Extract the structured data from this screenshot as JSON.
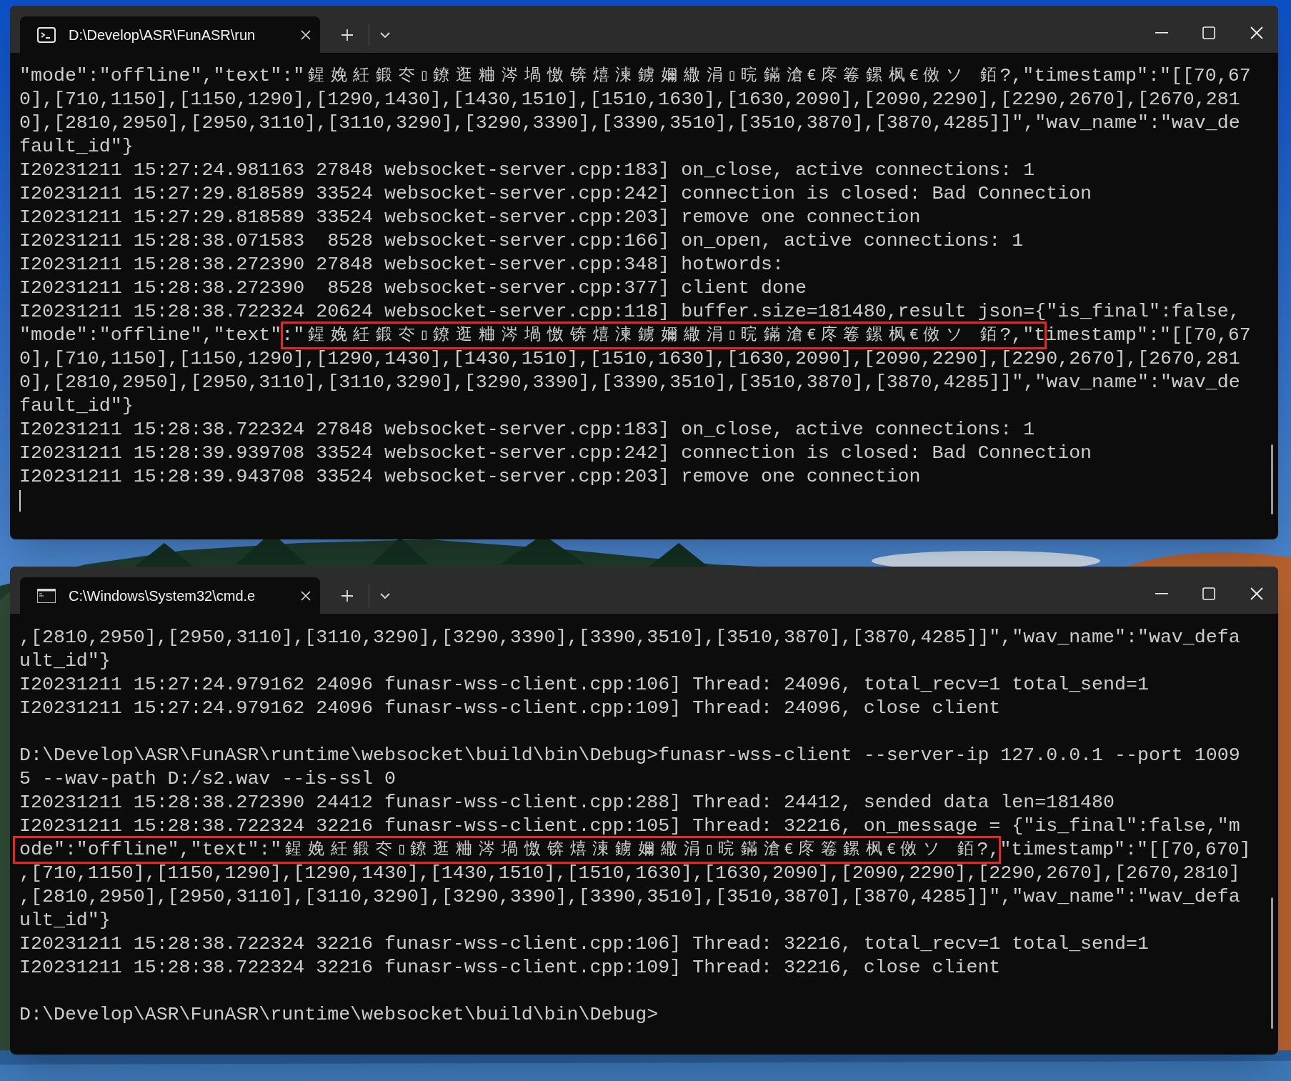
{
  "windows": [
    {
      "tab": {
        "title": "D:\\Develop\\ASR\\FunASR\\run"
      },
      "cursor_visible": true,
      "lines": [
        {
          "kind": "text",
          "text": "\"mode\":\"offline\",\"text\":\"鍟娩紝鍛冭▯鐐逛粬涔堝憿锛熺湅鐪嬭繖涓▯晥鏋滄€庝箞鏍枫€傚ソ 銆?,\"timestamp\":\"[[70,67",
          "highlighted": false
        },
        {
          "kind": "text",
          "text": "0],[710,1150],[1150,1290],[1290,1430],[1430,1510],[1510,1630],[1630,2090],[2090,2290],[2290,2670],[2670,281",
          "highlighted": false
        },
        {
          "kind": "text",
          "text": "0],[2810,2950],[2950,3110],[3110,3290],[3290,3390],[3390,3510],[3510,3870],[3870,4285]]\",\"wav_name\":\"wav_de",
          "highlighted": false
        },
        {
          "kind": "text",
          "text": "fault_id\"}",
          "highlighted": false
        },
        {
          "kind": "text",
          "text": "I20231211 15:27:24.981163 27848 websocket-server.cpp:183] on_close, active connections: 1",
          "highlighted": false
        },
        {
          "kind": "text",
          "text": "I20231211 15:27:29.818589 33524 websocket-server.cpp:242] connection is closed: Bad Connection",
          "highlighted": false
        },
        {
          "kind": "text",
          "text": "I20231211 15:27:29.818589 33524 websocket-server.cpp:203] remove one connection",
          "highlighted": false
        },
        {
          "kind": "text",
          "text": "I20231211 15:28:38.071583  8528 websocket-server.cpp:166] on_open, active connections: 1",
          "highlighted": false
        },
        {
          "kind": "text",
          "text": "I20231211 15:28:38.272390 27848 websocket-server.cpp:348] hotwords:",
          "highlighted": false
        },
        {
          "kind": "text",
          "text": "I20231211 15:28:38.272390  8528 websocket-server.cpp:377] client done",
          "highlighted": false
        },
        {
          "kind": "text",
          "text": "I20231211 15:28:38.722324 20624 websocket-server.cpp:118] buffer.size=181480,result json={\"is_final\":false,",
          "highlighted": false
        },
        {
          "kind": "text",
          "text": "\"mode\":\"offline\",\"text\":\"鍟娩紝鍛冭▯鐐逛粬涔堝憿锛熺湅鐪嬭繖涓▯晥鏋滄€庝箞鏍枫€傚ソ 銆?,\"timestamp\":\"[[70,67",
          "highlighted": true
        },
        {
          "kind": "text",
          "text": "0],[710,1150],[1150,1290],[1290,1430],[1430,1510],[1510,1630],[1630,2090],[2090,2290],[2290,2670],[2670,281",
          "highlighted": false
        },
        {
          "kind": "text",
          "text": "0],[2810,2950],[2950,3110],[3110,3290],[3290,3390],[3390,3510],[3510,3870],[3870,4285]]\",\"wav_name\":\"wav_de",
          "highlighted": false
        },
        {
          "kind": "text",
          "text": "fault_id\"}",
          "highlighted": false
        },
        {
          "kind": "text",
          "text": "I20231211 15:28:38.722324 27848 websocket-server.cpp:183] on_close, active connections: 1",
          "highlighted": false
        },
        {
          "kind": "text",
          "text": "I20231211 15:28:39.939708 33524 websocket-server.cpp:242] connection is closed: Bad Connection",
          "highlighted": false
        },
        {
          "kind": "text",
          "text": "I20231211 15:28:39.943708 33524 websocket-server.cpp:203] remove one connection",
          "highlighted": false
        }
      ]
    },
    {
      "tab": {
        "title": "C:\\Windows\\System32\\cmd.e"
      },
      "cursor_visible": false,
      "lines": [
        {
          "kind": "text",
          "text": ",[2810,2950],[2950,3110],[3110,3290],[3290,3390],[3390,3510],[3510,3870],[3870,4285]]\",\"wav_name\":\"wav_defa",
          "highlighted": false
        },
        {
          "kind": "text",
          "text": "ult_id\"}",
          "highlighted": false
        },
        {
          "kind": "text",
          "text": "I20231211 15:27:24.979162 24096 funasr-wss-client.cpp:106] Thread: 24096, total_recv=1 total_send=1",
          "highlighted": false
        },
        {
          "kind": "text",
          "text": "I20231211 15:27:24.979162 24096 funasr-wss-client.cpp:109] Thread: 24096, close client",
          "highlighted": false
        },
        {
          "kind": "blank"
        },
        {
          "kind": "text",
          "text": "D:\\Develop\\ASR\\FunASR\\runtime\\websocket\\build\\bin\\Debug>funasr-wss-client --server-ip 127.0.0.1 --port 1009",
          "highlighted": false
        },
        {
          "kind": "text",
          "text": "5 --wav-path D:/s2.wav --is-ssl 0",
          "highlighted": false
        },
        {
          "kind": "text",
          "text": "I20231211 15:28:38.272390 24412 funasr-wss-client.cpp:288] Thread: 24412, sended data len=181480",
          "highlighted": false
        },
        {
          "kind": "text",
          "text": "I20231211 15:28:38.722324 32216 funasr-wss-client.cpp:105] Thread: 32216, on_message = {\"is_final\":false,\"m",
          "highlighted": false
        },
        {
          "kind": "text",
          "text": "ode\":\"offline\",\"text\":\"鍟娩紝鍛冭▯鐐逛粬涔堝憿锛熺湅鐪嬭繖涓▯晥鏋滄€庝箞鏍枫€傚ソ 銆?,\"timestamp\":\"[[70,670]",
          "highlighted": true
        },
        {
          "kind": "text",
          "text": ",[710,1150],[1150,1290],[1290,1430],[1430,1510],[1510,1630],[1630,2090],[2090,2290],[2290,2670],[2670,2810]",
          "highlighted": false
        },
        {
          "kind": "text",
          "text": ",[2810,2950],[2950,3110],[3110,3290],[3290,3390],[3390,3510],[3510,3870],[3870,4285]]\",\"wav_name\":\"wav_defa",
          "highlighted": false
        },
        {
          "kind": "text",
          "text": "ult_id\"}",
          "highlighted": false
        },
        {
          "kind": "text",
          "text": "I20231211 15:28:38.722324 32216 funasr-wss-client.cpp:106] Thread: 32216, total_recv=1 total_send=1",
          "highlighted": false
        },
        {
          "kind": "text",
          "text": "I20231211 15:28:38.722324 32216 funasr-wss-client.cpp:109] Thread: 32216, close client",
          "highlighted": false
        },
        {
          "kind": "blank"
        },
        {
          "kind": "text",
          "text": "D:\\Develop\\ASR\\FunASR\\runtime\\websocket\\build\\bin\\Debug>",
          "highlighted": false
        }
      ]
    }
  ]
}
